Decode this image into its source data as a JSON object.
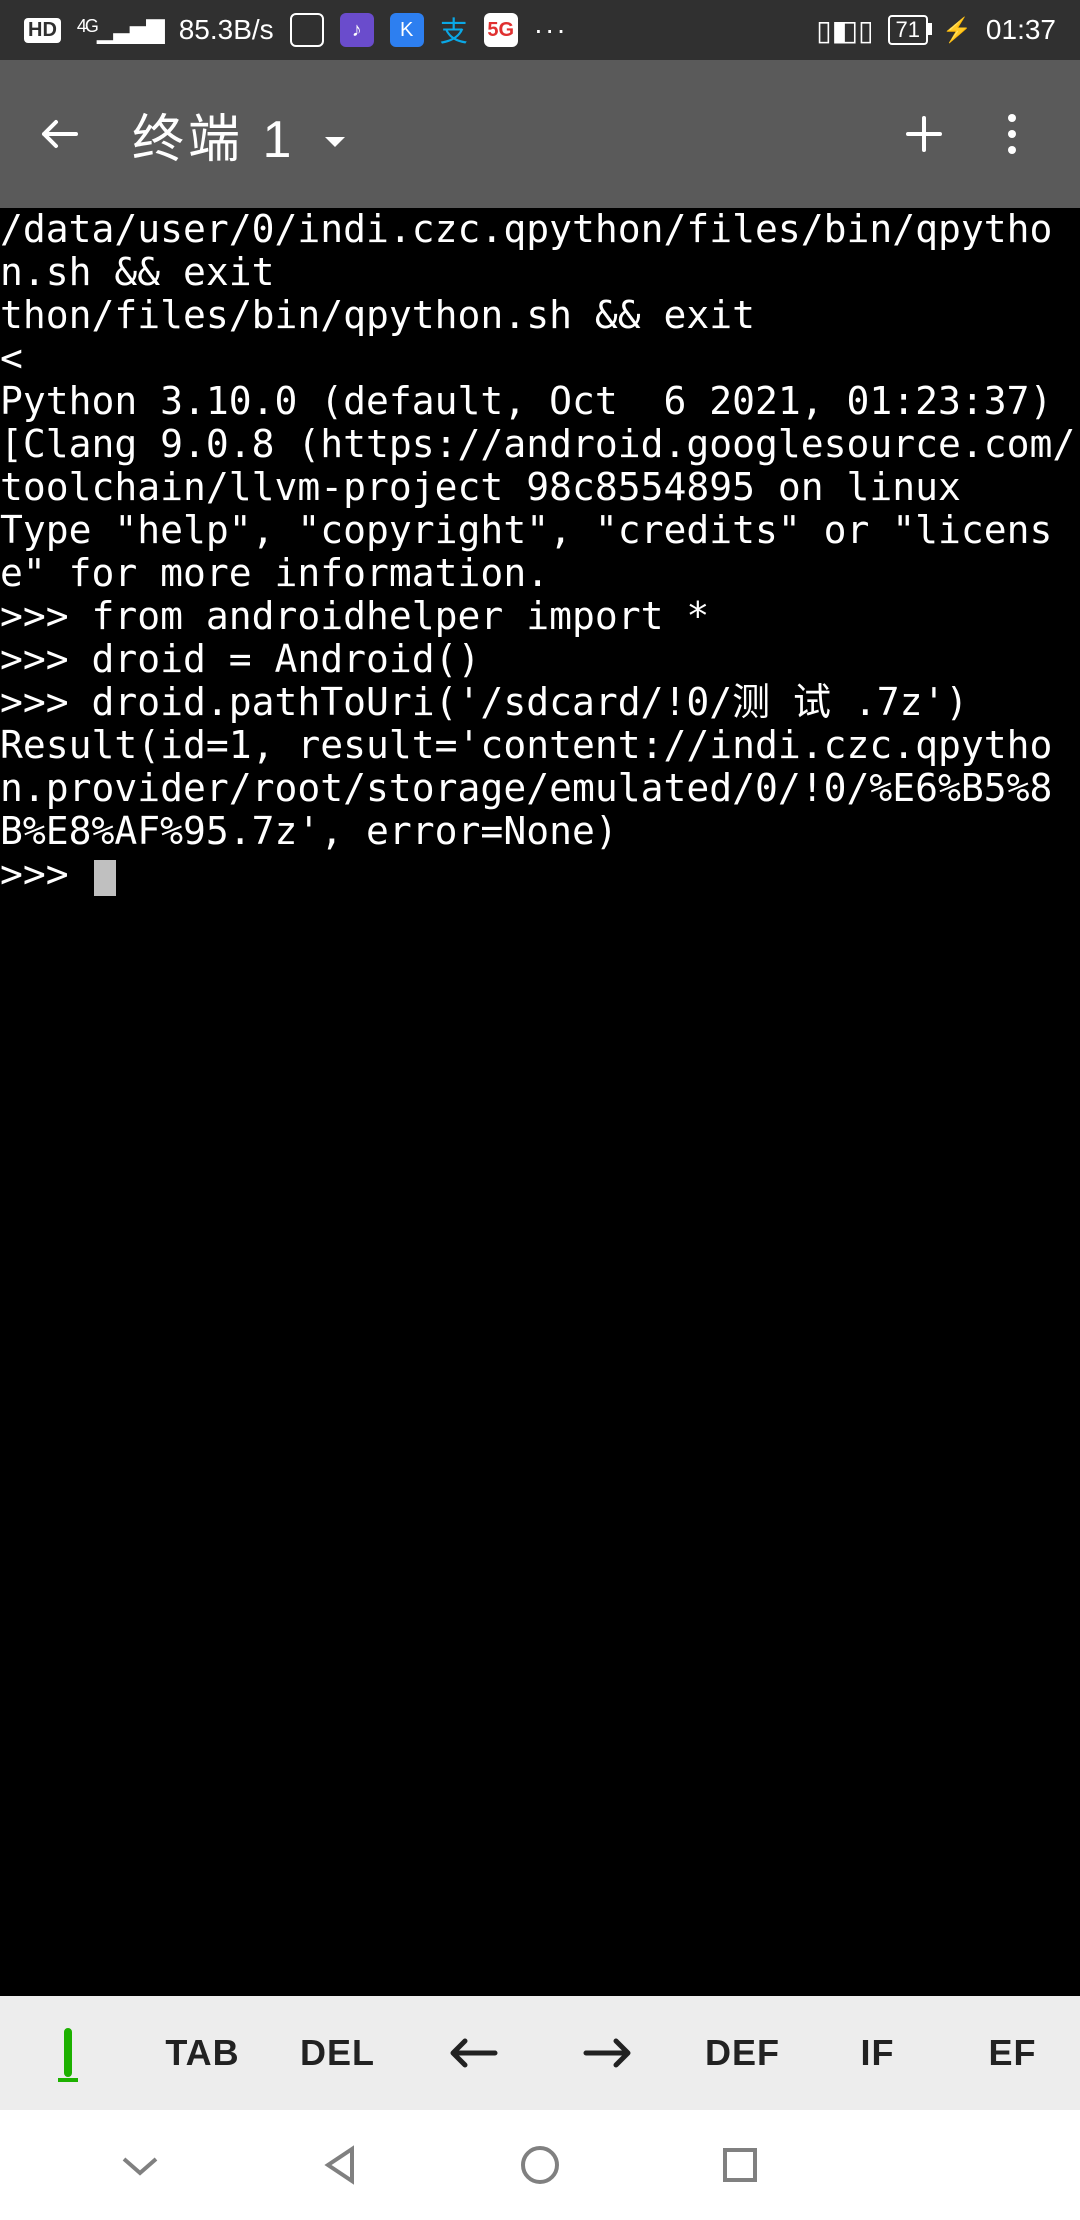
{
  "status": {
    "hd": "HD",
    "network": "4G",
    "speed": "85.3B/s",
    "battery": "71",
    "time": "01:37"
  },
  "appbar": {
    "title": "终端 1"
  },
  "terminal": {
    "lines": [
      "/data/user/0/indi.czc.qpython/files/bin/qpython.sh && exit",
      "thon/files/bin/qpython.sh && exit                    <",
      "Python 3.10.0 (default, Oct  6 2021, 01:23:37) [Clang 9.0.8 (https://android.googlesource.com/toolchain/llvm-project 98c8554895 on linux",
      "Type \"help\", \"copyright\", \"credits\" or \"license\" for more information.",
      ">>> from androidhelper import *",
      ">>> droid = Android()",
      ">>> droid.pathToUri('/sdcard/!0/测 试 .7z')",
      "Result(id=1, result='content://indi.czc.qpython.provider/root/storage/emulated/0/!0/%E6%B5%8B%E8%AF%95.7z', error=None)"
    ],
    "prompt": ">>> "
  },
  "toolbar": {
    "tab": "TAB",
    "del": "DEL",
    "def": "DEF",
    "if": "IF",
    "ef": "EF"
  }
}
